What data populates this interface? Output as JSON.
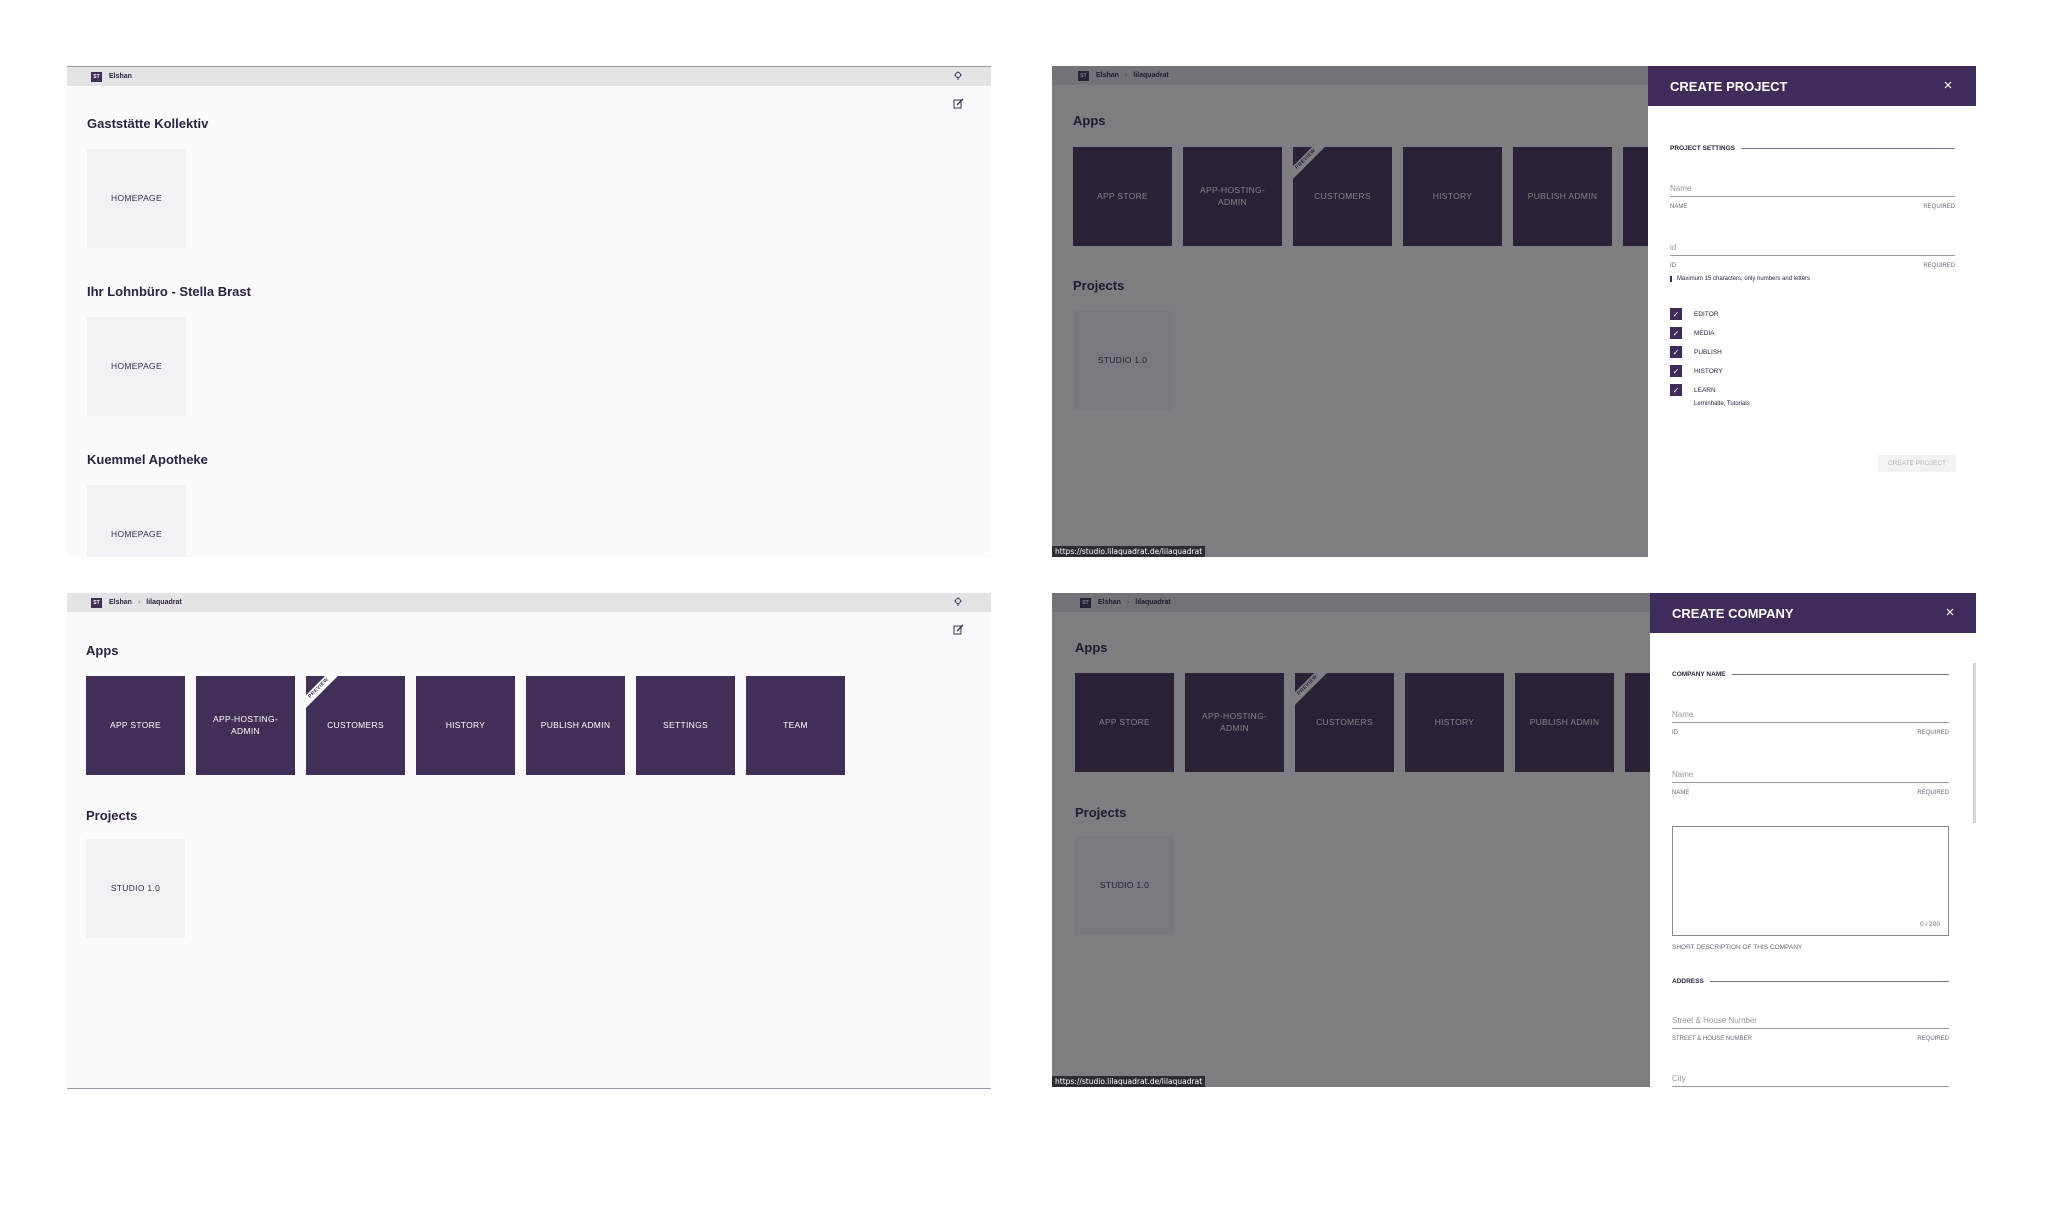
{
  "crumbs": {
    "user": "Elshan",
    "company": "lilaquadrat",
    "logo": "ST"
  },
  "panel1": {
    "sections": [
      {
        "title": "Gaststätte Kollektiv",
        "tile": "HOMEPAGE"
      },
      {
        "title": "Ihr Lohnbüro - Stella Brast",
        "tile": "HOMEPAGE"
      },
      {
        "title": "Kuemmel Apotheke",
        "tile": "HOMEPAGE"
      }
    ]
  },
  "apps_heading": "Apps",
  "projects_heading": "Projects",
  "apps": [
    "APP STORE",
    "APP-HOSTING-ADMIN",
    "CUSTOMERS",
    "HISTORY",
    "PUBLISH ADMIN",
    "SETTINGS",
    "TEAM"
  ],
  "preview_ribbon": "PREVIEW",
  "project_tile": "STUDIO 1.0",
  "status_url": "https://studio.lilaquadrat.de/lilaquadrat",
  "create_project": {
    "title": "CREATE PROJECT",
    "section": "PROJECT SETTINGS",
    "name_placeholder": "Name",
    "name_label": "NAME",
    "id_placeholder": "id",
    "id_label": "ID",
    "required": "REQUIRED",
    "hint": "Maximum 15 characters, only numbers and letters",
    "checkboxes": [
      "EDITOR",
      "MEDIA",
      "PUBLISH",
      "HISTORY",
      "LEARN"
    ],
    "learn_sub": "Lerninhalte, Tutorials",
    "button": "CREATE PROJECT"
  },
  "create_company": {
    "title": "CREATE COMPANY",
    "section": "COMPANY NAME",
    "id_placeholder": "Name",
    "id_label": "ID",
    "name_placeholder": "Name",
    "name_label": "NAME",
    "required": "REQUIRED",
    "counter": "0 / 200",
    "desc_label": "SHORT DESCRIPTION OF THIS COMPANY",
    "address_section": "ADDRESS",
    "street_placeholder": "Street & House Number",
    "street_label": "STREET & HOUSE NUMBER",
    "city_placeholder": "City"
  },
  "colors": {
    "brand": "#412f58",
    "tile_light": "#f3f1f5",
    "overlay": "#18161e"
  },
  "icons": [
    "bulb-icon",
    "edit-icon",
    "close-icon",
    "check-icon"
  ]
}
